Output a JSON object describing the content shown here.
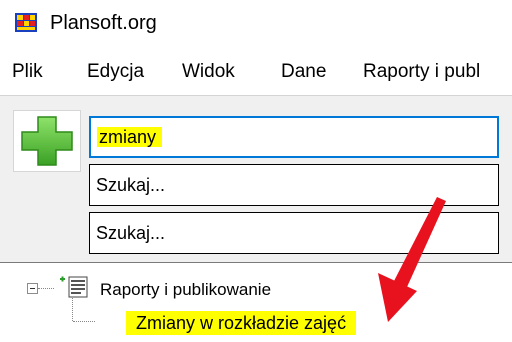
{
  "window": {
    "title": "Plansoft.org"
  },
  "menu": {
    "items": [
      "Plik",
      "Edycja",
      "Widok",
      "Dane",
      "Raporty i publ"
    ]
  },
  "search": {
    "field1_value": "zmiany",
    "field2_placeholder": "Szukaj...",
    "field3_placeholder": "Szukaj..."
  },
  "tree": {
    "root_label": "Raporty i publikowanie",
    "child_label": "Zmiany w rozkładzie zajęć"
  },
  "colors": {
    "highlight": "#ffff00",
    "accent": "#0078d7",
    "arrow": "#e8121f",
    "plus": "#5cc43b"
  },
  "icons": {
    "app": "plansoft-logo-icon",
    "add": "green-plus-icon",
    "node": "tree-node-icon",
    "annotation": "red-arrow-icon"
  }
}
